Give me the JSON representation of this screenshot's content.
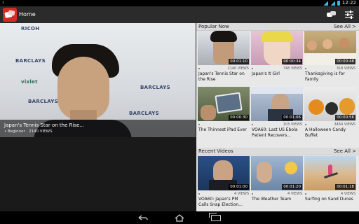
{
  "status": {
    "time": "12:22",
    "warning_glyph": "!"
  },
  "app": {
    "title": "Home"
  },
  "hero": {
    "title": "Japan's Tennis Star on the Rise...",
    "level": "Beginner",
    "views": "2140 VIEWS",
    "sponsors": [
      "RICOH",
      "BARCLAYS",
      "vixlet",
      "BARCLAYS",
      "BARCLAYS",
      "BARCLAYS"
    ]
  },
  "popular": {
    "title": "Popular Now",
    "see_all": "See All >",
    "items": [
      {
        "title": "Japan's Tennis Star on the Rise",
        "views": "2140 VIEWS",
        "duration": "00:01:10"
      },
      {
        "title": "Japan's It Girl",
        "views": "748 VIEWS",
        "duration": "00:00:34"
      },
      {
        "title": "Thanksgiving is for Family",
        "views": "318 VIEWS",
        "duration": "00:00:48"
      },
      {
        "title": "The Thinnest iPad Ever",
        "views": "",
        "duration": "00:00:30"
      },
      {
        "title": "VOA60: Last US Ebola Patient Recovers...",
        "views": "103 VIEWS",
        "duration": "00:01:06"
      },
      {
        "title": "A Halloween Candy Buffet",
        "views": "3464 VIEWS",
        "duration": "00:00:56"
      }
    ]
  },
  "recent": {
    "title": "Recent Videos",
    "see_all": "See All >",
    "items": [
      {
        "title": "VOA60: Japan's PM Calls Snap Election...",
        "views": "4 VIEWS",
        "duration": "00:01:00"
      },
      {
        "title": "The Weather Team",
        "views": "4 VIEWS",
        "duration": "00:01:20"
      },
      {
        "title": "Surfing on Sand Dunes",
        "views": "4 VIEWS",
        "duration": "00:01:18"
      }
    ]
  },
  "colors": {
    "brand": "#d52b27",
    "accent": "#39b6e6"
  }
}
